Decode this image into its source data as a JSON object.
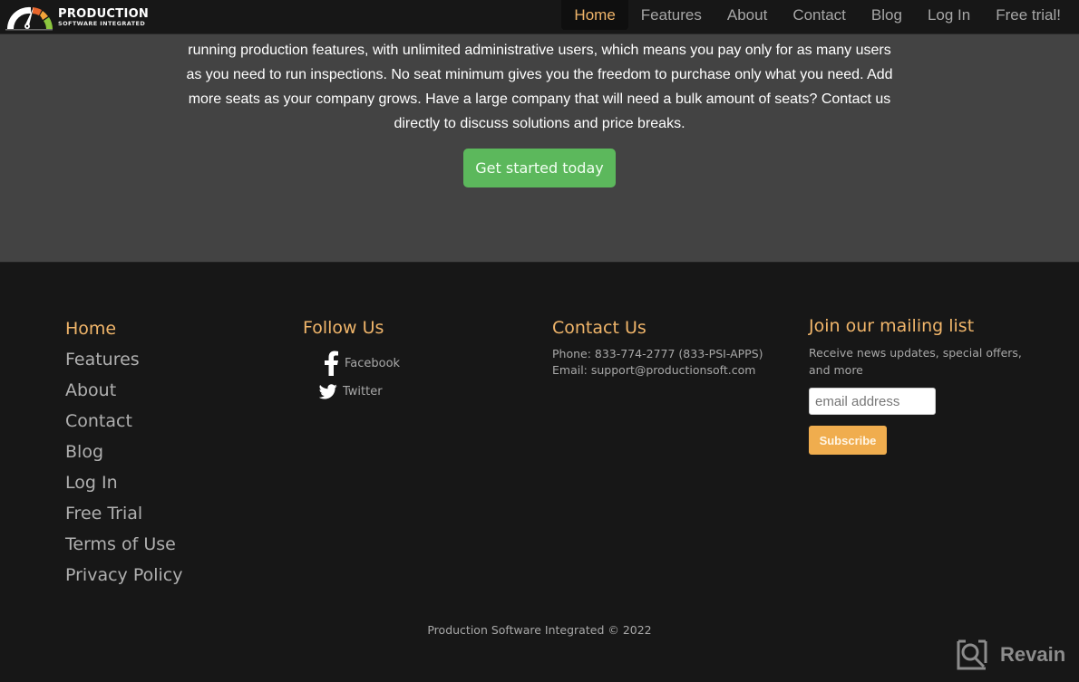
{
  "header": {
    "logo": {
      "title": "PRODUCTION",
      "subtitle": "SOFTWARE INTEGRATED",
      "icon": "speedometer-gauge-icon"
    },
    "nav": [
      {
        "label": "Home",
        "active": true
      },
      {
        "label": "Features",
        "active": false
      },
      {
        "label": "About",
        "active": false
      },
      {
        "label": "Contact",
        "active": false
      },
      {
        "label": "Blog",
        "active": false
      },
      {
        "label": "Log In",
        "active": false
      },
      {
        "label": "Free trial!",
        "active": false
      }
    ]
  },
  "hero": {
    "text": "running production features, with unlimited administrative users, which means you pay only for as many users as you need to run inspections. No seat minimum gives you the freedom to purchase only what you need. Add more seats as your company grows. Have a large company that will need a bulk amount of seats? Contact us directly to discuss solutions and price breaks.",
    "cta_label": "Get started today"
  },
  "footer": {
    "links": [
      {
        "label": "Home",
        "active": true
      },
      {
        "label": "Features",
        "active": false
      },
      {
        "label": "About",
        "active": false
      },
      {
        "label": "Contact",
        "active": false
      },
      {
        "label": "Blog",
        "active": false
      },
      {
        "label": "Log In",
        "active": false
      },
      {
        "label": "Free Trial",
        "active": false
      },
      {
        "label": "Terms of Use",
        "active": false
      },
      {
        "label": "Privacy Policy",
        "active": false
      }
    ],
    "follow": {
      "title": "Follow Us",
      "items": [
        {
          "label": "Facebook",
          "icon": "facebook-icon"
        },
        {
          "label": "Twitter",
          "icon": "twitter-icon"
        }
      ]
    },
    "contact": {
      "title": "Contact Us",
      "phone": "Phone: 833-774-2777 (833-PSI-APPS)",
      "email": "Email: support@productionsoft.com"
    },
    "mailing": {
      "title": "Join our mailing list",
      "description": "Receive news updates, special offers, and more",
      "email_placeholder": "email address",
      "email_value": "",
      "subscribe_label": "Subscribe"
    },
    "copyright": "Production Software Integrated © 2022"
  },
  "watermark": {
    "label": "Revain",
    "icon": "revain-logo-icon"
  },
  "colors": {
    "accent": "#f0b56a",
    "cta_green": "#5cb85c",
    "subscribe_orange": "#f0ad4e",
    "hero_bg": "#434343",
    "footer_bg": "#171717"
  }
}
